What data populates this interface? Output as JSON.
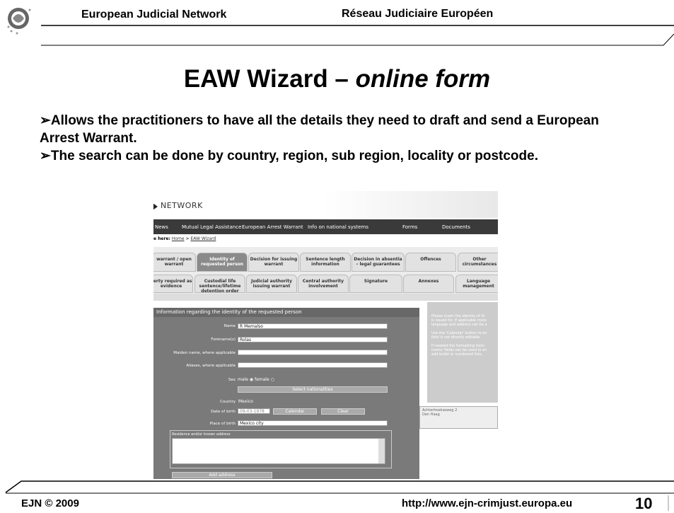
{
  "header": {
    "left": "European Judicial Network",
    "right": "Réseau Judiciaire Européen"
  },
  "title": {
    "main": "EAW Wizard – ",
    "italic": "online form"
  },
  "bullets": [
    "➢Allows the practitioners to have all the details they need to draft and send a European Arrest Warrant.",
    "➢The search can be done by country, region, sub region, locality or postcode."
  ],
  "footer": {
    "left": "EJN © 2009",
    "url": "http://www.ejn-crimjust.europa.eu",
    "page": "10"
  },
  "screenshot": {
    "logo": "NETWORK",
    "menu": [
      "News",
      "Mutual Legal Assistance",
      "European Arrest Warrant",
      "Info on national systems",
      "Forms",
      "Documents"
    ],
    "breadcrumb": {
      "prefix": "e here:",
      "home": "Home",
      "sep": ">",
      "page": "EAW Wizard"
    },
    "tabs_row1": [
      "warrant / open warrant",
      "Identity of requested person",
      "Decision for issuing warrant",
      "Sentence length information",
      "Decision in absentia – legal guarantees",
      "Offences",
      "Other circumstances"
    ],
    "tabs_row2": [
      "perty required as evidence",
      "Custodial life sentence/lifetime detention order",
      "Judicial authority issuing warrant",
      "Central authority involvement",
      "Signature",
      "Annexes",
      "Language management"
    ],
    "form_title": "Information regarding the identity of the requested person",
    "fields": {
      "name_label": "Name",
      "name_value": "R Memalso",
      "forename_label": "Forename(s)",
      "forename_value": "Rolas",
      "maiden_label": "Maiden name, where applicable",
      "maiden_value": "",
      "aliases_label": "Aliases, where applicable",
      "aliases_value": "",
      "sex_label": "Sex",
      "sex_male": "male",
      "sex_female": "female",
      "nationalities_btn": "Select nationalities",
      "country_label": "Country",
      "country_value": "Mexico",
      "dob_label": "Date of birth",
      "dob_value": "09-03-1978",
      "calendar_btn": "Calendar",
      "clear_btn": "Clear",
      "pob_label": "Place of birth",
      "pob_value": "Mexico city",
      "residence_label": "Residence and/or known address",
      "add_address_btn": "Add address"
    },
    "help": [
      "Please insert the identity of th",
      "is issued for. If applicable more",
      "language and address can be a",
      "Use the 'Calendar' button to en",
      "field is not directly editable.",
      "If needed the formatting tools",
      "marks' fields can be used to en",
      "add bullet or numbered lists."
    ],
    "address": [
      "Achterhoekseweg 2",
      "Den Haag"
    ]
  }
}
